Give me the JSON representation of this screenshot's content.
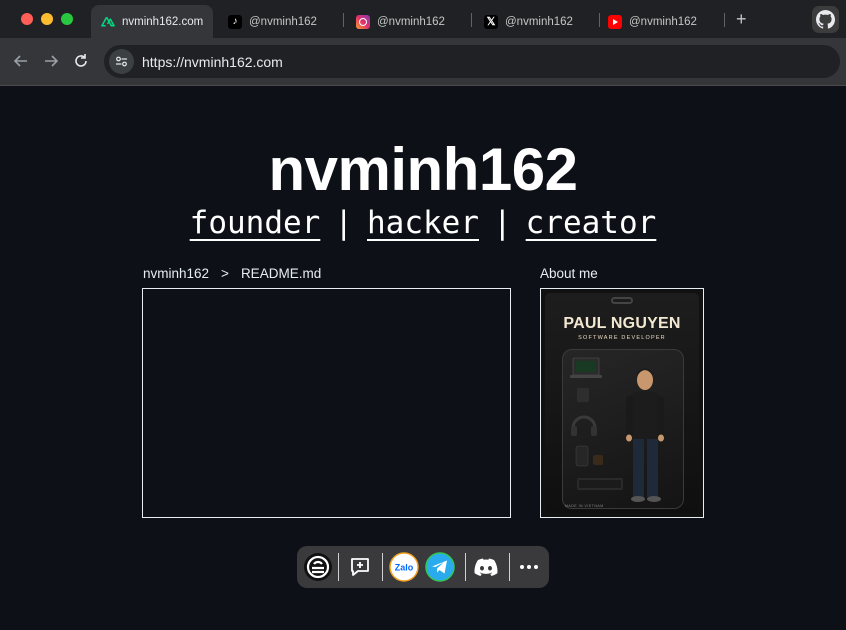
{
  "browser": {
    "tabs": [
      {
        "label": "nvminh162.com",
        "favicon": "nuxt-icon",
        "active": true
      },
      {
        "label": "@nvminh162",
        "favicon": "tiktok-icon",
        "active": false
      },
      {
        "label": "@nvminh162",
        "favicon": "instagram-icon",
        "active": false
      },
      {
        "label": "@nvminh162",
        "favicon": "x-icon",
        "active": false
      },
      {
        "label": "@nvminh162",
        "favicon": "youtube-icon",
        "active": false
      }
    ],
    "new_tab_symbol": "+",
    "url": "https://nvminh162.com"
  },
  "hero": {
    "title": "nvminh162",
    "roles": [
      "founder",
      "hacker",
      "creator"
    ],
    "separator": "|"
  },
  "readme": {
    "breadcrumb_user": "nvminh162",
    "breadcrumb_arrow": ">",
    "breadcrumb_file": "README.md"
  },
  "about": {
    "label": "About me",
    "figure_name": "PAUL NGUYEN",
    "figure_role": "SOFTWARE DEVELOPER",
    "figure_footnote": "MADE IN VIETNAM"
  },
  "dock": {
    "items": [
      "app-logo-icon",
      "message-plus-icon",
      "zalo-icon",
      "telegram-icon",
      "discord-icon",
      "more-icon"
    ],
    "zalo_text": "Zalo"
  },
  "colors": {
    "page_bg": "#0d1117",
    "text": "#e6edf3",
    "tab_bar": "#202124",
    "toolbar": "#35363a",
    "telegram": "#2aabee",
    "zalo": "#0068ff"
  }
}
